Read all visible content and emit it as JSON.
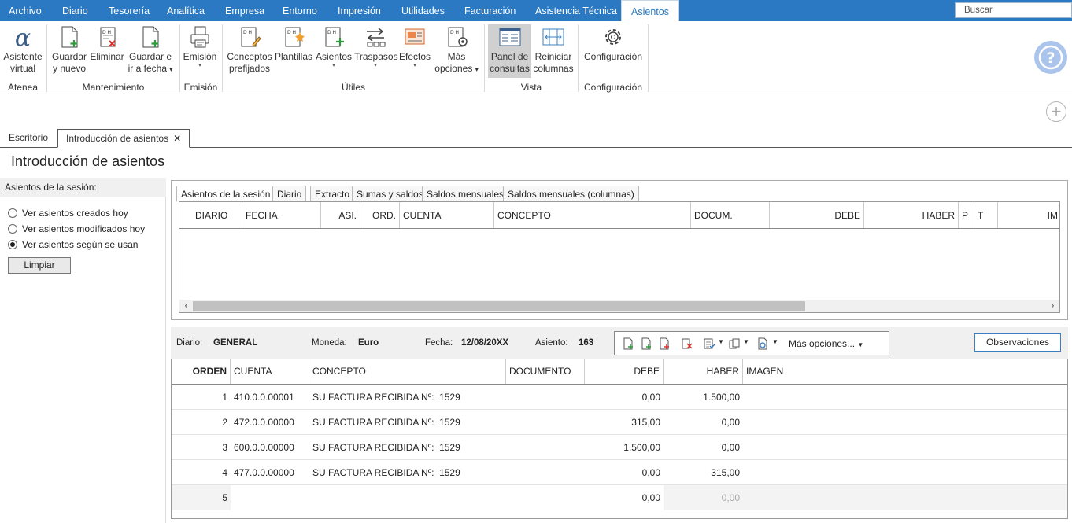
{
  "menubar": {
    "items": [
      "Archivo",
      "Diario",
      "Tesorería",
      "Analítica",
      "Empresa",
      "Entorno",
      "Impresión",
      "Utilidades",
      "Facturación",
      "Asistencia Técnica",
      "Asientos"
    ],
    "search_placeholder": "Buscar"
  },
  "ribbon": {
    "atenea": {
      "asistente": "Asistente",
      "asistente2": "virtual",
      "group": "Atenea"
    },
    "mantenimiento": {
      "guardar_nuevo": "Guardar",
      "guardar_nuevo2": "y nuevo",
      "eliminar": "Eliminar",
      "guardar_fecha": "Guardar e",
      "guardar_fecha2": "ir a fecha",
      "group": "Mantenimiento"
    },
    "emision": {
      "emision": "Emisión",
      "group": "Emisión"
    },
    "utiles": {
      "conceptos": "Conceptos",
      "conceptos2": "prefijados",
      "plantillas": "Plantillas",
      "asientos": "Asientos",
      "traspasos": "Traspasos",
      "efectos": "Efectos",
      "mas": "Más",
      "mas2": "opciones",
      "group": "Útiles"
    },
    "vista": {
      "panel": "Panel de",
      "panel2": "consultas",
      "reiniciar": "Reiniciar",
      "reiniciar2": "columnas",
      "group": "Vista"
    },
    "configuracion": {
      "config": "Configuración",
      "group": "Configuración"
    }
  },
  "doc_tabs": [
    "Escritorio",
    "Introducción de asientos"
  ],
  "page_title": "Introducción de asientos",
  "left_panel": {
    "header": "Asientos de la sesión:",
    "options": [
      "Ver asientos creados hoy",
      "Ver asientos modificados hoy",
      "Ver asientos según se usan"
    ],
    "selected_index": 2,
    "clear_button": "Limpiar"
  },
  "inner_tabs": [
    "Asientos de la sesión",
    "Diario",
    "Extracto",
    "Sumas y saldos",
    "Saldos mensuales",
    "Saldos mensuales (columnas)"
  ],
  "session_grid": {
    "columns": [
      "DIARIO",
      "FECHA",
      "ASI.",
      "ORD.",
      "CUENTA",
      "CONCEPTO",
      "DOCUM.",
      "DEBE",
      "HABER",
      "P",
      "T",
      "IM"
    ]
  },
  "info": {
    "diario_label": "Diario:",
    "diario_value": "GENERAL",
    "moneda_label": "Moneda:",
    "moneda_value": "Euro",
    "fecha_label": "Fecha:",
    "fecha_value": "12/08/20XX",
    "asiento_label": "Asiento:",
    "asiento_value": "163",
    "more_options": "Más opciones...",
    "observaciones_button": "Observaciones"
  },
  "entries_grid": {
    "columns": [
      "ORDEN",
      "CUENTA",
      "CONCEPTO",
      "DOCUMENTO",
      "DEBE",
      "HABER",
      "IMAGEN"
    ],
    "rows": [
      {
        "orden": "1",
        "cuenta": "410.0.0.00001",
        "concepto": "SU FACTURA RECIBIDA Nº:  1529",
        "documento": "",
        "debe": "0,00",
        "haber": "1.500,00"
      },
      {
        "orden": "2",
        "cuenta": "472.0.0.00000",
        "concepto": "SU FACTURA RECIBIDA Nº:  1529",
        "documento": "",
        "debe": "315,00",
        "haber": "0,00"
      },
      {
        "orden": "3",
        "cuenta": "600.0.0.00000",
        "concepto": "SU FACTURA RECIBIDA Nº:  1529",
        "documento": "",
        "debe": "1.500,00",
        "haber": "0,00"
      },
      {
        "orden": "4",
        "cuenta": "477.0.0.00000",
        "concepto": "SU FACTURA RECIBIDA Nº:  1529",
        "documento": "",
        "debe": "0,00",
        "haber": "315,00"
      },
      {
        "orden": "5",
        "cuenta": "",
        "concepto": "",
        "documento": "",
        "debe": "0,00",
        "haber": "0,00"
      }
    ]
  },
  "colors": {
    "menubar": "#2b79c2",
    "accent": "#3c7dc4",
    "help": "#aac4ec"
  }
}
